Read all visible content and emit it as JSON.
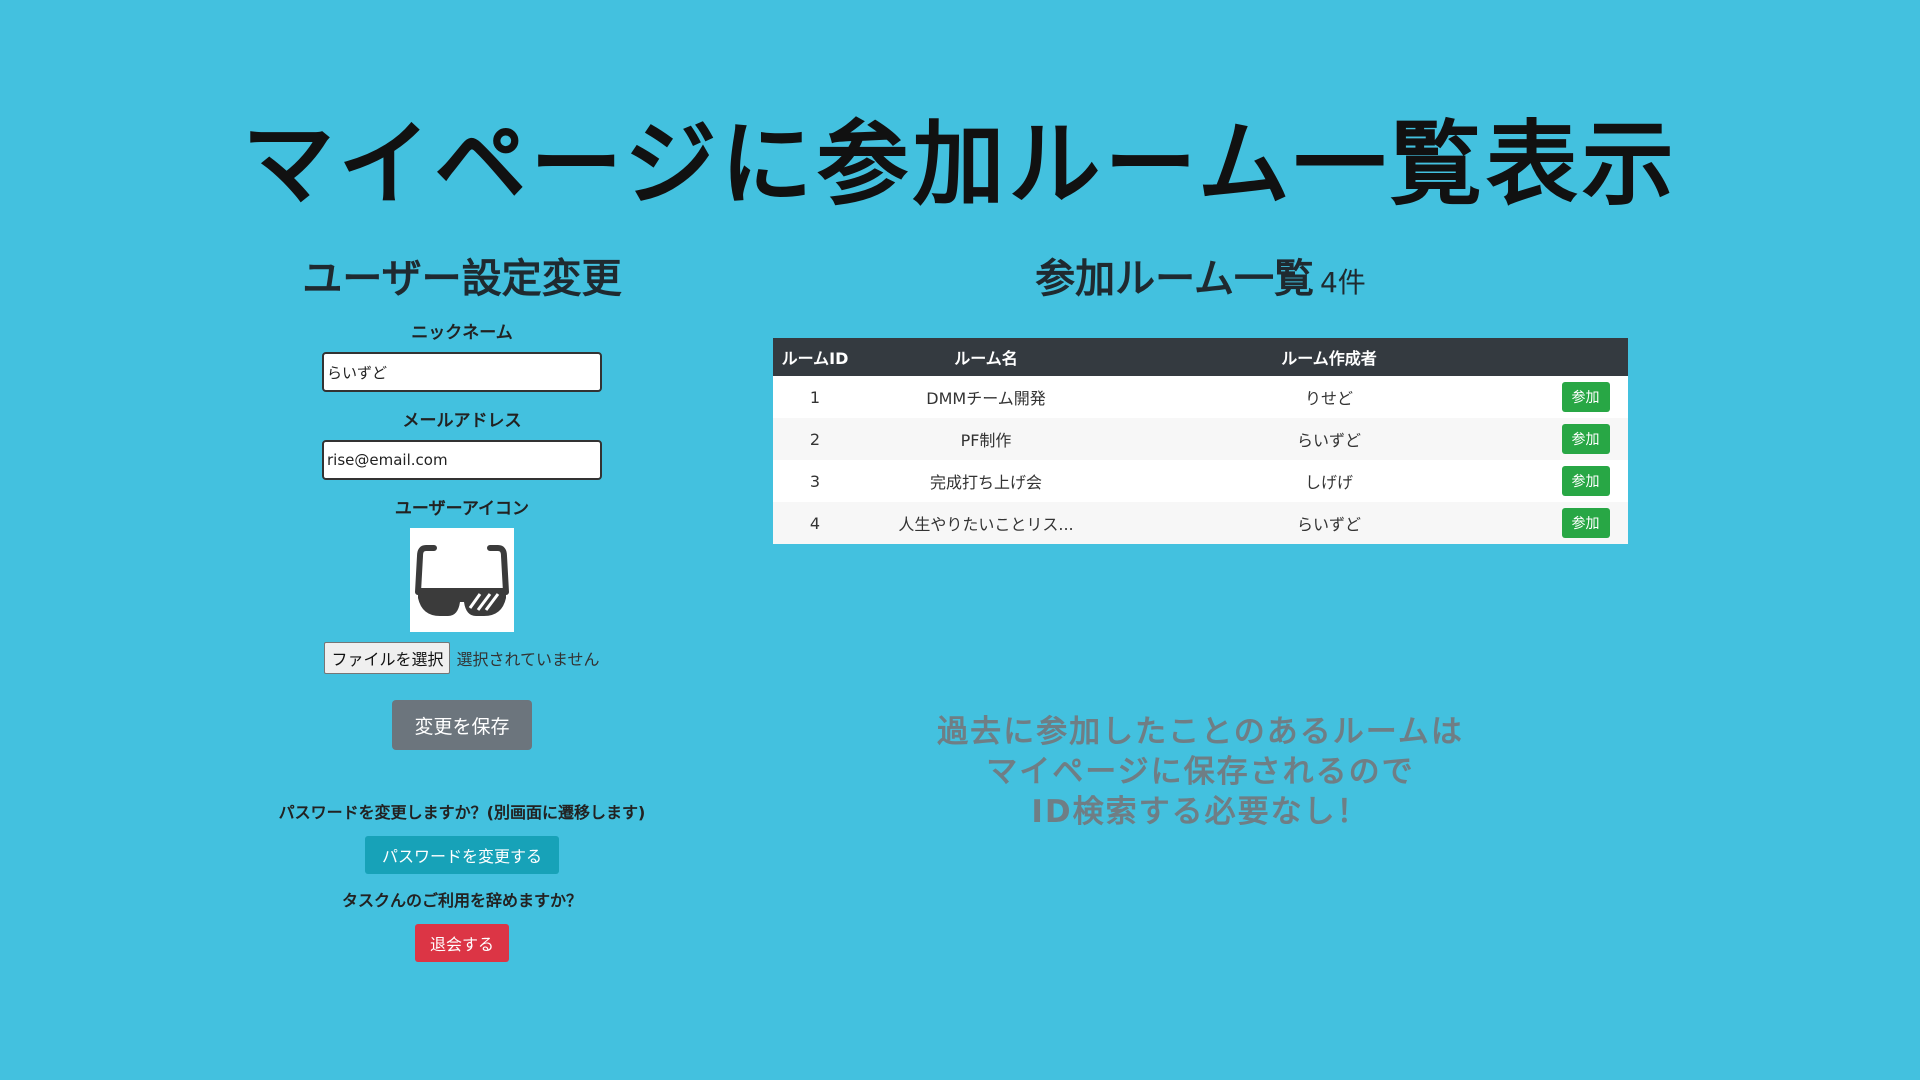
{
  "title": "マイページに参加ルーム一覧表示",
  "user_settings": {
    "heading": "ユーザー設定変更",
    "nickname_label": "ニックネーム",
    "nickname_value": "らいずど",
    "email_label": "メールアドレス",
    "email_value": "rise@email.com",
    "icon_label": "ユーザーアイコン",
    "icon_name": "sunglasses-icon",
    "file_button_label": "ファイルを選択",
    "file_status": "選択されていません",
    "save_button_label": "変更を保存",
    "password_question": "パスワードを変更しますか？(別画面に遷移します)",
    "password_button_label": "パスワードを変更する",
    "quit_question": "タスクんのご利用を辞めますか？",
    "quit_button_label": "退会する"
  },
  "rooms": {
    "heading": "参加ルーム一覧",
    "count": "4件",
    "columns": [
      "ルームID",
      "ルーム名",
      "ルーム作成者",
      ""
    ],
    "rows": [
      {
        "id": "1",
        "name": "DMMチーム開発",
        "creator": "りせど",
        "action": "参加"
      },
      {
        "id": "2",
        "name": "PF制作",
        "creator": "らいずど",
        "action": "参加"
      },
      {
        "id": "3",
        "name": "完成打ち上げ会",
        "creator": "しげげ",
        "action": "参加"
      },
      {
        "id": "4",
        "name": "人生やりたいことリス...",
        "creator": "らいずど",
        "action": "参加"
      }
    ]
  },
  "note": {
    "lines": [
      "過去に参加したことのあるルームは",
      "マイページに保存されるので",
      "ID検索する必要なし！"
    ]
  },
  "colors": {
    "background": "#43c1df",
    "save_button": "#6c757d",
    "password_button": "#17a2b8",
    "quit_button": "#dc3545",
    "join_button": "#28a745",
    "table_header": "#343a40"
  }
}
